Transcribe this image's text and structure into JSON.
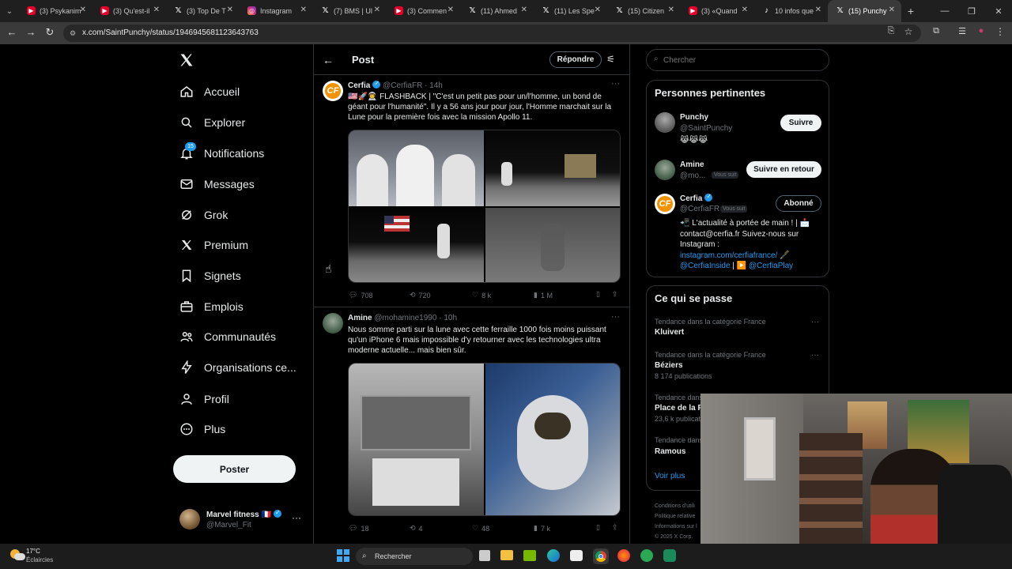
{
  "browser": {
    "tabs": [
      {
        "title": "(3) Psykanim",
        "icon": "youtube-icon"
      },
      {
        "title": "(3) Qu'est-il",
        "icon": "youtube-icon"
      },
      {
        "title": "(3) Top De T",
        "icon": "x-icon"
      },
      {
        "title": "Instagram",
        "icon": "instagram-icon"
      },
      {
        "title": "(7) BMS | Ul",
        "icon": "x-icon"
      },
      {
        "title": "(3) Commen",
        "icon": "youtube-icon"
      },
      {
        "title": "(11) Ahmed",
        "icon": "x-icon"
      },
      {
        "title": "(11) Les Spe",
        "icon": "x-icon"
      },
      {
        "title": "(15) Citizen",
        "icon": "x-icon"
      },
      {
        "title": "(3) «Quand",
        "icon": "youtube-icon"
      },
      {
        "title": "10 infos que",
        "icon": "tiktok-icon"
      },
      {
        "title": "(15) Punchy",
        "icon": "x-icon",
        "active": true
      }
    ],
    "url": "x.com/SaintPunchy/status/1946945681123643763"
  },
  "sidebar": {
    "items": [
      {
        "label": "Accueil",
        "icon": "home-icon"
      },
      {
        "label": "Explorer",
        "icon": "search-icon"
      },
      {
        "label": "Notifications",
        "icon": "bell-icon",
        "badge": "15"
      },
      {
        "label": "Messages",
        "icon": "mail-icon"
      },
      {
        "label": "Grok",
        "icon": "grok-icon"
      },
      {
        "label": "Premium",
        "icon": "x-logo-icon"
      },
      {
        "label": "Signets",
        "icon": "bookmark-icon"
      },
      {
        "label": "Emplois",
        "icon": "briefcase-icon"
      },
      {
        "label": "Communautés",
        "icon": "people-icon"
      },
      {
        "label": "Organisations ce...",
        "icon": "lightning-icon"
      },
      {
        "label": "Profil",
        "icon": "person-icon"
      },
      {
        "label": "Plus",
        "icon": "more-circle-icon"
      }
    ],
    "post_button": "Poster",
    "account": {
      "name": "Marvel fitness",
      "flag": "🇫🇷",
      "handle": "@Marvel_Fit"
    }
  },
  "main": {
    "header": {
      "title": "Post",
      "reply_button": "Répondre"
    },
    "tweets": [
      {
        "name": "Cerfia",
        "handle": "@CerfiaFR",
        "time": "14h",
        "text": "🇺🇸🚀👨‍🚀 FLASHBACK | \"C'est un petit pas pour un/l'homme, un bond de géant pour l'humanité\". Il y a 56 ans jour pour jour, l'Homme marchait sur la Lune pour la première fois avec la mission Apollo 11.",
        "replies": "708",
        "reposts": "720",
        "likes": "8 k",
        "views": "1 M"
      },
      {
        "name": "Amine",
        "handle": "@mohamine1990",
        "time": "10h",
        "text": "Nous somme parti sur la lune avec cette ferraille 1000 fois moins puissant qu'un iPhone 6 mais impossible d'y retourner avec les technologies ultra moderne actuelle... mais bien sûr.",
        "replies": "18",
        "reposts": "4",
        "likes": "48",
        "views": "7 k"
      }
    ]
  },
  "right": {
    "search_placeholder": "Chercher",
    "relevant": {
      "title": "Personnes pertinentes",
      "people": [
        {
          "name": "Punchy",
          "handle": "@SaintPunchy",
          "bio": "😹😹😹",
          "button": "Suivre"
        },
        {
          "name": "Amine",
          "handle": "@mo...",
          "follows_you": "Vous suit",
          "button": "Suivre en retour"
        },
        {
          "name": "Cerfia",
          "handle": "@CerfiaFR",
          "follows_you": "Vous suit",
          "button": "Abonné",
          "bio_line1": "📲 L'actualité à portée de main ! | 📩",
          "bio_line2": "contact@cerfia.fr Suivez-nous sur",
          "bio_line3": "Instagram :",
          "bio_link1": "instagram.com/cerfiafrance/ 🖋️",
          "bio_link2": "@CerfiaInside",
          "bio_sep": " | ▶️ ",
          "bio_link3": "@CerfiaPlay"
        }
      ]
    },
    "trends": {
      "title": "Ce qui se passe",
      "items": [
        {
          "category": "Tendance dans la catégorie France",
          "name": "Kluivert",
          "count": ""
        },
        {
          "category": "Tendance dans la catégorie France",
          "name": "Béziers",
          "count": "8 174 publications"
        },
        {
          "category": "Tendance dans",
          "name": "Place de la R",
          "count": "23,6 k publicat"
        },
        {
          "category": "Tendance dans",
          "name": "Ramous",
          "count": ""
        }
      ],
      "more": "Voir plus"
    },
    "footer": [
      "Conditions d'utili",
      "Politique relative",
      "Informations sur l",
      "© 2025 X Corp."
    ]
  },
  "taskbar": {
    "weather_temp": "17°C",
    "weather_desc": "Éclaircies",
    "search": "Rechercher"
  },
  "colors": {
    "accent": "#1d9bf0",
    "link": "#1d9bf0",
    "bg": "#000000",
    "border": "#2f3336",
    "muted": "#71767b"
  }
}
